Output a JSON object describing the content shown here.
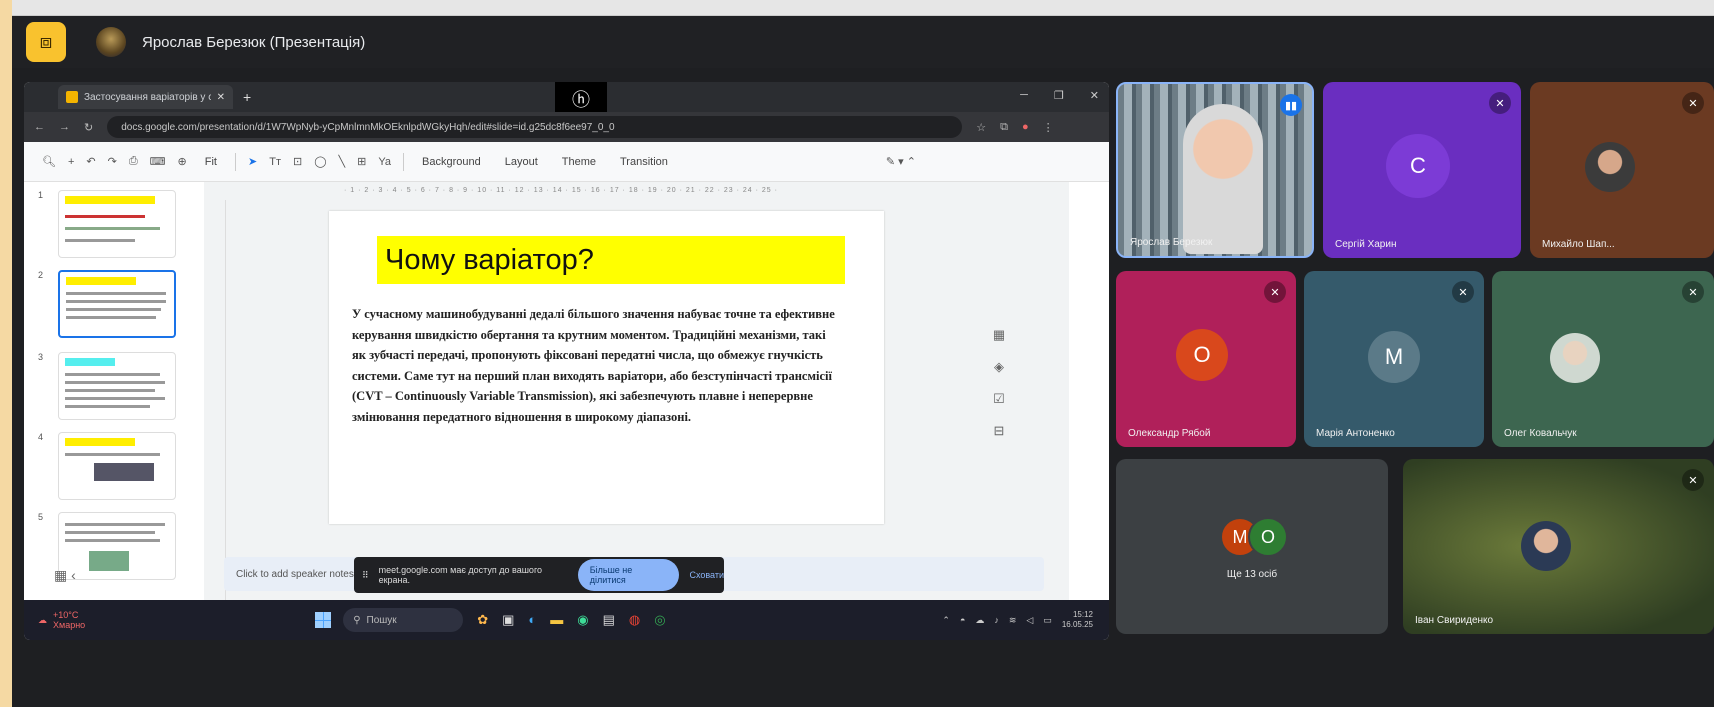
{
  "header": {
    "presenter_title": "Ярослав Березюк (Презентація)"
  },
  "browser": {
    "tab_title": "Застосування варіаторів у с...",
    "url": "docs.google.com/presentation/d/1W7WpNyb-yCpMnlmnMkOEknlpdWGkyHqh/edit#slide=id.g25dc8f6ee97_0_0"
  },
  "toolbar": {
    "zoom": "Fit",
    "background": "Background",
    "layout": "Layout",
    "theme": "Theme",
    "transition": "Transition"
  },
  "thumbnails": [
    "1",
    "2",
    "3",
    "4",
    "5"
  ],
  "slide": {
    "title": "Чому варіатор?",
    "body": "У сучасному машинобудуванні дедалі більшого значення набуває точне та ефективне керування швидкістю обертання та крутним моментом. Традиційні механізми, такі як зубчасті передачі, пропонують фіксовані передатні числа, що обмежує гнучкість системи. Саме тут на перший план виходять варіатори, або безступінчасті трансмісії (CVT – Continuously Variable Transmission), які забезпечують плавне і неперервне змінювання передатного відношення в широкому діапазоні."
  },
  "notes": {
    "placeholder": "Click to add speaker notes"
  },
  "sharing_bar": {
    "message": "meet.google.com має доступ до вашого екрана.",
    "stop_label": "Більше не ділитися",
    "hide_label": "Сховати"
  },
  "taskbar": {
    "weather_temp": "+10°C",
    "weather_desc": "Хмарно",
    "search_placeholder": "Пошук",
    "time": "15:12",
    "date": "16.05.25"
  },
  "participants": [
    {
      "name": "Ярослав Березюк",
      "type": "video",
      "bg": "#8fa3b0"
    },
    {
      "name": "Сергій Харин",
      "initial": "C",
      "bg": "#6a2ec0",
      "avatar_color": "#7c3bd6"
    },
    {
      "name": "Михайло Шап...",
      "type": "photo",
      "bg": "#6b3a22"
    },
    {
      "name": "Олександр Рябой",
      "initial": "О",
      "bg": "#b0205a",
      "avatar_color": "#d9481c"
    },
    {
      "name": "Марія Антоненко",
      "initial": "M",
      "bg": "#355a6b",
      "avatar_color": "#5b7a88"
    },
    {
      "name": "Олег Ковальчук",
      "type": "photo",
      "bg": "#3d6650"
    },
    {
      "name": "Ще 13 осіб",
      "initials": [
        "M",
        "O"
      ],
      "bg": "#3c4043"
    },
    {
      "name": "Іван Свириденко",
      "type": "photo",
      "bg": "#3f5a2b"
    }
  ],
  "colors": {
    "app_bg": "#1e1f22",
    "accent_yellow": "#f9c22e",
    "slide_highlight": "#ffff00",
    "mic_off_badge": "rgba(0,0,0,0.35)"
  }
}
